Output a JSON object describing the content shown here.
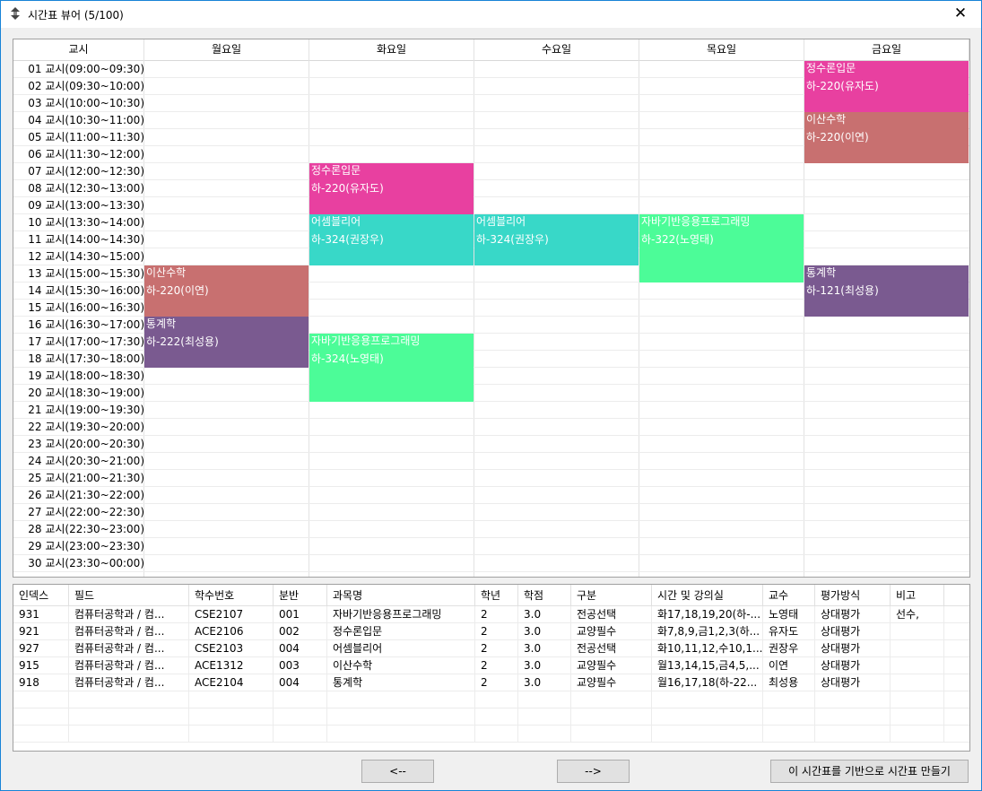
{
  "window": {
    "title": "시간표 뷰어 (5/100)",
    "close_label": "✕"
  },
  "grid": {
    "headers": [
      "교시",
      "월요일",
      "화요일",
      "수요일",
      "목요일",
      "금요일"
    ],
    "periods": [
      "01 교시(09:00~09:30)",
      "02 교시(09:30~10:00)",
      "03 교시(10:00~10:30)",
      "04 교시(10:30~11:00)",
      "05 교시(11:00~11:30)",
      "06 교시(11:30~12:00)",
      "07 교시(12:00~12:30)",
      "08 교시(12:30~13:00)",
      "09 교시(13:00~13:30)",
      "10 교시(13:30~14:00)",
      "11 교시(14:00~14:30)",
      "12 교시(14:30~15:00)",
      "13 교시(15:00~15:30)",
      "14 교시(15:30~16:00)",
      "15 교시(16:00~16:30)",
      "16 교시(16:30~17:00)",
      "17 교시(17:00~17:30)",
      "18 교시(17:30~18:00)",
      "19 교시(18:00~18:30)",
      "20 교시(18:30~19:00)",
      "21 교시(19:00~19:30)",
      "22 교시(19:30~20:00)",
      "23 교시(20:00~20:30)",
      "24 교시(20:30~21:00)",
      "25 교시(21:00~21:30)",
      "26 교시(21:30~22:00)",
      "27 교시(22:00~22:30)",
      "28 교시(22:30~23:00)",
      "29 교시(23:00~23:30)",
      "30 교시(23:30~00:00)"
    ],
    "blocks": [
      {
        "day": 5,
        "start": 1,
        "end": 3,
        "name": "정수론입문",
        "room": "하-220(유자도)",
        "color": "#e840a0"
      },
      {
        "day": 5,
        "start": 4,
        "end": 6,
        "name": "이산수학",
        "room": "하-220(이연)",
        "color": "#c87070"
      },
      {
        "day": 2,
        "start": 7,
        "end": 9,
        "name": "정수론입문",
        "room": "하-220(유자도)",
        "color": "#e840a0"
      },
      {
        "day": 2,
        "start": 10,
        "end": 12,
        "name": "어셈블리어",
        "room": "하-324(권장우)",
        "color": "#38d8c8"
      },
      {
        "day": 3,
        "start": 10,
        "end": 12,
        "name": "어셈블리어",
        "room": "하-324(권장우)",
        "color": "#38d8c8"
      },
      {
        "day": 4,
        "start": 10,
        "end": 13,
        "name": "자바기반응용프로그래밍",
        "room": "하-322(노영태)",
        "color": "#4cfc98"
      },
      {
        "day": 1,
        "start": 13,
        "end": 15,
        "name": "이산수학",
        "room": "하-220(이연)",
        "color": "#c87070"
      },
      {
        "day": 5,
        "start": 13,
        "end": 15,
        "name": "통계학",
        "room": "하-121(최성용)",
        "color": "#7a5a90"
      },
      {
        "day": 1,
        "start": 16,
        "end": 18,
        "name": "통계학",
        "room": "하-222(최성용)",
        "color": "#7a5a90"
      },
      {
        "day": 2,
        "start": 17,
        "end": 20,
        "name": "자바기반응용프로그래밍",
        "room": "하-324(노영태)",
        "color": "#4cfc98"
      }
    ]
  },
  "table": {
    "columns": [
      "인덱스",
      "필드",
      "학수번호",
      "분반",
      "과목명",
      "학년",
      "학점",
      "구분",
      "시간 및 강의실",
      "교수",
      "평가방식",
      "비고"
    ],
    "rows": [
      [
        "931",
        "컴퓨터공학과 / 컴...",
        "CSE2107",
        "001",
        "자바기반응용프로그래밍",
        "2",
        "3.0",
        "전공선택",
        "화17,18,19,20(하-...",
        "노영태",
        "상대평가",
        "선수,"
      ],
      [
        "921",
        "컴퓨터공학과 / 컴...",
        "ACE2106",
        "002",
        "정수론입문",
        "2",
        "3.0",
        "교양필수",
        "화7,8,9,금1,2,3(하...",
        "유자도",
        "상대평가",
        ""
      ],
      [
        "927",
        "컴퓨터공학과 / 컴...",
        "CSE2103",
        "004",
        "어셈블리어",
        "2",
        "3.0",
        "전공선택",
        "화10,11,12,수10,1...",
        "권장우",
        "상대평가",
        ""
      ],
      [
        "915",
        "컴퓨터공학과 / 컴...",
        "ACE1312",
        "003",
        "이산수학",
        "2",
        "3.0",
        "교양필수",
        "월13,14,15,금4,5,...",
        "이연",
        "상대평가",
        ""
      ],
      [
        "918",
        "컴퓨터공학과 / 컴...",
        "ACE2104",
        "004",
        "통계학",
        "2",
        "3.0",
        "교양필수",
        "월16,17,18(하-22...",
        "최성용",
        "상대평가",
        ""
      ]
    ]
  },
  "buttons": {
    "prev": "<--",
    "next": "-->",
    "create": "이 시간표를 기반으로 시간표 만들기"
  }
}
